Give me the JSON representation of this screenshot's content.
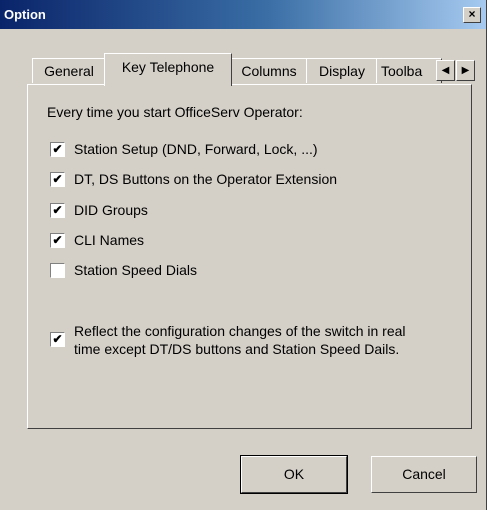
{
  "window": {
    "title": "Option",
    "close_glyph": "×"
  },
  "tabs": [
    {
      "label": "General",
      "active": false
    },
    {
      "label": "Key Telephone",
      "active": true
    },
    {
      "label": "Columns",
      "active": false
    },
    {
      "label": "Display",
      "active": false
    },
    {
      "label": "Toolba",
      "active": false
    }
  ],
  "tab_scroll": {
    "left_glyph": "◀",
    "right_glyph": "▶"
  },
  "panel": {
    "intro": "Every time you start OfficeServ Operator:",
    "checkboxes": [
      {
        "label": "Station Setup (DND, Forward, Lock, ...)",
        "checked": true
      },
      {
        "label": "DT, DS Buttons on the Operator Extension",
        "checked": true
      },
      {
        "label": "DID Groups",
        "checked": true
      },
      {
        "label": "CLI Names",
        "checked": true
      },
      {
        "label": "Station Speed Dials",
        "checked": false
      }
    ],
    "reflect": {
      "line1": "Reflect the configuration changes of the switch in real",
      "line2": "time except DT/DS buttons and Station Speed Dails.",
      "checked": true
    }
  },
  "buttons": {
    "ok": "OK",
    "cancel": "Cancel"
  },
  "check_glyph": "✔"
}
